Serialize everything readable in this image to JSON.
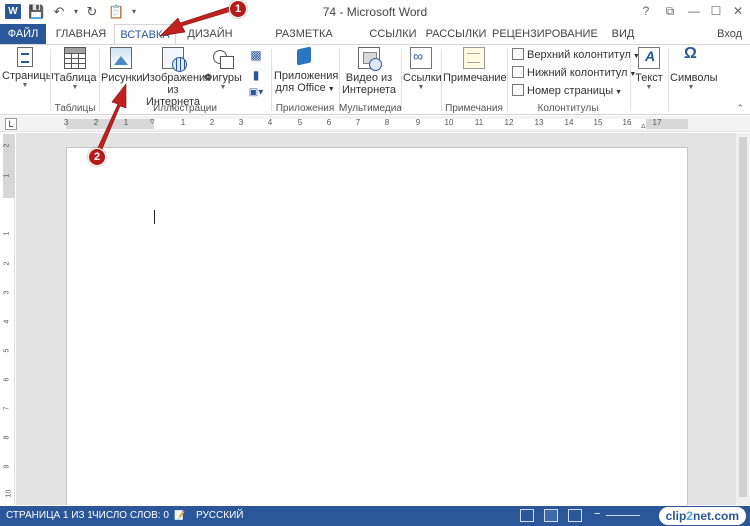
{
  "titlebar": {
    "logo": "W",
    "title": "74 - Microsoft Word",
    "qat": [
      "save-icon",
      "undo-icon",
      "redo-icon",
      "paste-icon",
      "dropdown-icon"
    ],
    "controls": {
      "help": "?",
      "restore": "⧉",
      "minimize": "—",
      "maximize": "☐",
      "close": "✕"
    }
  },
  "tabs": [
    {
      "label": "ФАЙЛ"
    },
    {
      "label": "ГЛАВНАЯ"
    },
    {
      "label": "ВСТАВКА"
    },
    {
      "label": "ДИЗАЙН"
    },
    {
      "label": "РАЗМЕТКА СТРАНИЦЫ"
    },
    {
      "label": "ССЫЛКИ"
    },
    {
      "label": "РАССЫЛКИ"
    },
    {
      "label": "РЕЦЕНЗИРОВАНИЕ"
    },
    {
      "label": "ВИД"
    }
  ],
  "signin": "Вход",
  "ribbon": {
    "pages": {
      "label": "Страницы"
    },
    "table": {
      "label": "Таблица",
      "group": "Таблицы"
    },
    "pictures": {
      "label": "Рисунки"
    },
    "online_pictures": {
      "label1": "Изображения",
      "label2": "из Интернета"
    },
    "shapes": {
      "label": "Фигуры"
    },
    "illustrations_group": "Иллюстрации",
    "apps": {
      "label1": "Приложения",
      "label2": "для Office",
      "group": "Приложения"
    },
    "video": {
      "label1": "Видео из",
      "label2": "Интернета",
      "group": "Мультимедиа"
    },
    "links": {
      "label": "Ссылки"
    },
    "comment": {
      "label": "Примечание",
      "group": "Примечания"
    },
    "header": {
      "label": "Верхний колонтитул"
    },
    "footer": {
      "label": "Нижний колонтитул"
    },
    "page_number": {
      "label": "Номер страницы"
    },
    "hf_group": "Колонтитулы",
    "text": {
      "label": "Текст"
    },
    "symbols": {
      "label": "Символы"
    }
  },
  "ruler": {
    "corner": "L",
    "ticks": [
      "3",
      "2",
      "1",
      "1",
      "2",
      "3",
      "4",
      "5",
      "6",
      "7",
      "8",
      "9",
      "10",
      "11",
      "12",
      "13",
      "14",
      "15",
      "16",
      "17"
    ]
  },
  "vruler": {
    "ticks": [
      "2",
      "1",
      "1",
      "2",
      "3",
      "4",
      "5",
      "6",
      "7",
      "8",
      "9",
      "10",
      "11",
      "12"
    ]
  },
  "statusbar": {
    "page": "СТРАНИЦА 1 ИЗ 1",
    "words": "ЧИСЛО СЛОВ: 0",
    "language": "РУССКИЙ",
    "watermark_a": "clip",
    "watermark_b": "2",
    "watermark_c": "net.com"
  },
  "annotations": [
    {
      "number": "1",
      "target": "ВСТАВКА tab"
    },
    {
      "number": "2",
      "target": "Рисунки button"
    }
  ],
  "colors": {
    "accent": "#2b579a",
    "arrow": "#c0211f"
  }
}
